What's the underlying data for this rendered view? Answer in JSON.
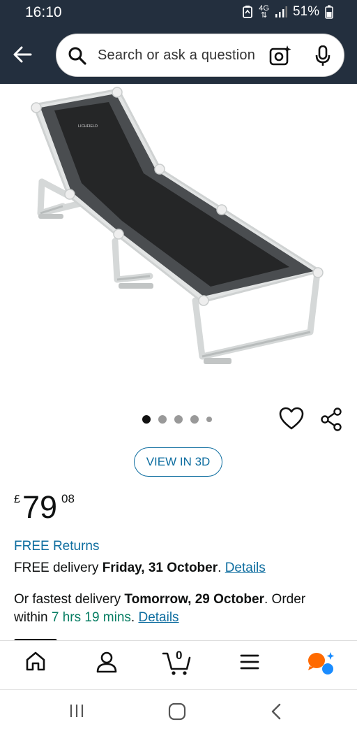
{
  "status_bar": {
    "time": "16:10",
    "network": "4G",
    "battery": "51%"
  },
  "search": {
    "placeholder": "Search or ask a question"
  },
  "product": {
    "image_brand_label": "LICHFIELD",
    "carousel": {
      "total": 5,
      "active_index": 0
    },
    "view_3d_label": "VIEW IN 3D",
    "price": {
      "currency": "£",
      "whole": "79",
      "fraction": "08"
    },
    "free_returns": "FREE Returns",
    "delivery": {
      "prefix": "FREE delivery ",
      "date": "Friday, 31 October",
      "suffix": ". ",
      "details": "Details"
    },
    "fastest": {
      "prefix": "Or fastest delivery ",
      "date": "Tomorrow, 29 October",
      "middle": ". Order within ",
      "countdown": "7 hrs 19 mins",
      "suffix": ". ",
      "details": "Details"
    }
  },
  "tab_bar": {
    "cart_count": "0",
    "items": [
      "home-icon",
      "account-icon",
      "cart-icon",
      "menu-icon",
      "assistant-icon"
    ]
  },
  "colors": {
    "header_bg": "#232f3e",
    "link": "#0f6ea0",
    "green": "#067d62",
    "assistant_orange": "#ff6a00",
    "assistant_blue": "#1a8cff"
  }
}
